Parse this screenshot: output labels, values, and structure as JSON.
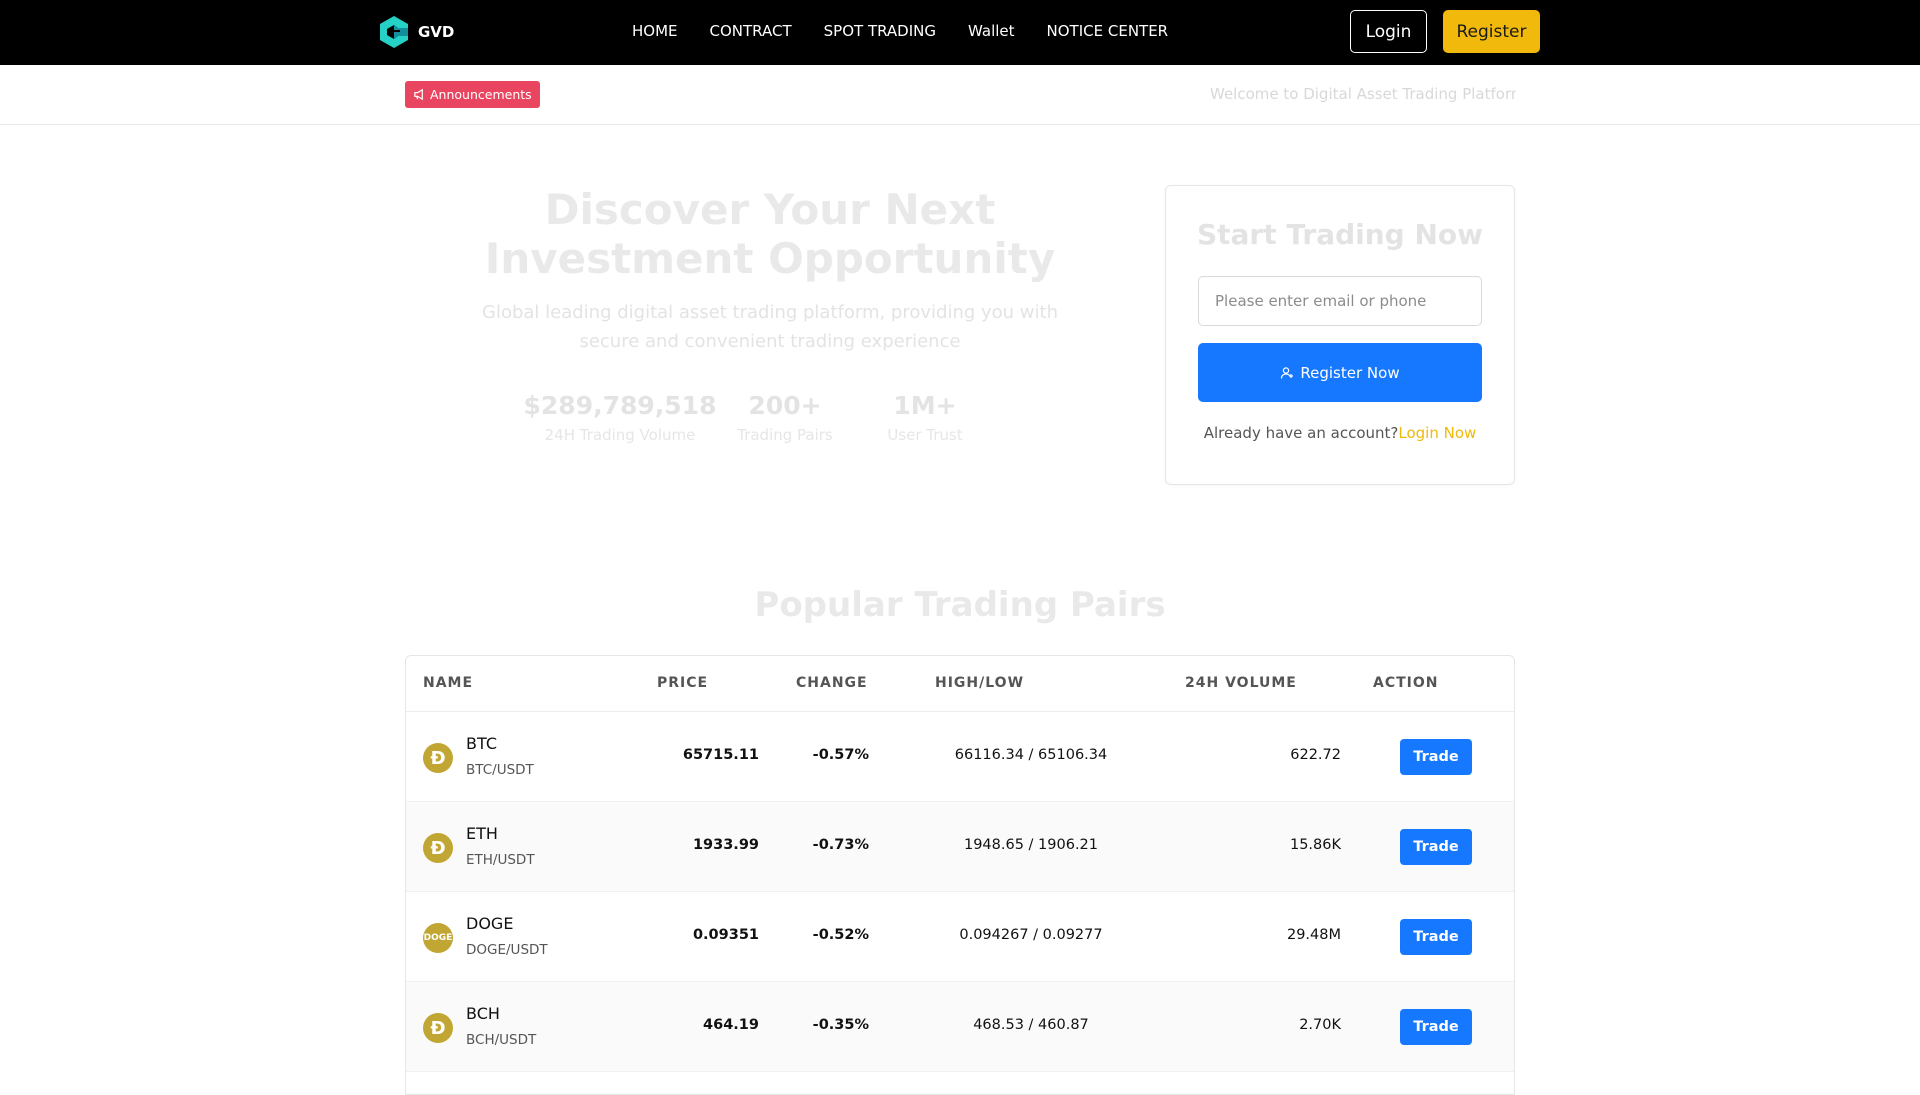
{
  "header": {
    "brand": "GVD",
    "nav": [
      "HOME",
      "CONTRACT",
      "SPOT TRADING",
      "Wallet",
      "NOTICE CENTER"
    ],
    "login_label": "Login",
    "register_label": "Register"
  },
  "announcement": {
    "badge": "Announcements",
    "text": "Welcome to Digital Asset Trading Platform | €"
  },
  "hero": {
    "title": "Discover Your Next Investment Opportunity",
    "subtitle": "Global leading digital asset trading platform, providing you with secure and convenient trading experience",
    "stats": [
      {
        "value": "$289,789,518",
        "label": "24H Trading Volume"
      },
      {
        "value": "200+",
        "label": "Trading Pairs"
      },
      {
        "value": "1M+",
        "label": "User Trust"
      }
    ]
  },
  "signup": {
    "title": "Start Trading Now",
    "input_placeholder": "Please enter email or phone",
    "button_label": "Register Now",
    "footer_text": "Already have an account?",
    "footer_link": "Login Now"
  },
  "pairs": {
    "title": "Popular Trading Pairs",
    "columns": [
      "NAME",
      "PRICE",
      "CHANGE",
      "HIGH/LOW",
      "24H VOLUME",
      "ACTION"
    ],
    "rows": [
      {
        "symbol": "BTC",
        "pair": "BTC/USDT",
        "icon": "Ð",
        "price": "65715.11",
        "change": "-0.57%",
        "high_low": "66116.34 / 65106.34",
        "volume": "622.72",
        "action": "Trade"
      },
      {
        "symbol": "ETH",
        "pair": "ETH/USDT",
        "icon": "Ð",
        "price": "1933.99",
        "change": "-0.73%",
        "high_low": "1948.65 / 1906.21",
        "volume": "15.86K",
        "action": "Trade"
      },
      {
        "symbol": "DOGE",
        "pair": "DOGE/USDT",
        "icon": "DOGE",
        "price": "0.09351",
        "change": "-0.52%",
        "high_low": "0.094267 / 0.09277",
        "volume": "29.48M",
        "action": "Trade"
      },
      {
        "symbol": "BCH",
        "pair": "BCH/USDT",
        "icon": "Ð",
        "price": "464.19",
        "change": "-0.35%",
        "high_low": "468.53 / 460.87",
        "volume": "2.70K",
        "action": "Trade"
      }
    ]
  }
}
